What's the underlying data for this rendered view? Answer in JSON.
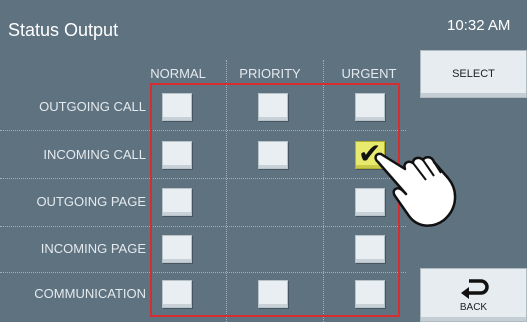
{
  "header": {
    "title": "Status Output",
    "time": "10:32 AM"
  },
  "columns": [
    "NORMAL",
    "PRIORITY",
    "URGENT"
  ],
  "rows": [
    {
      "label": "OUTGOING CALL",
      "cells": [
        false,
        false,
        false
      ]
    },
    {
      "label": "INCOMING CALL",
      "cells": [
        false,
        false,
        true
      ]
    },
    {
      "label": "OUTGOING PAGE",
      "cells": [
        false,
        null,
        false
      ]
    },
    {
      "label": "INCOMING PAGE",
      "cells": [
        false,
        null,
        false
      ]
    },
    {
      "label": "COMMUNICATION",
      "cells": [
        false,
        false,
        false
      ]
    }
  ],
  "buttons": {
    "select": "SELECT",
    "back": "BACK"
  },
  "colors": {
    "background": "#5f7280",
    "highlight_frame": "#d62e30",
    "checked_fill": "#e8ea6e"
  },
  "icons": {
    "back": "back-arrow-icon",
    "pointer": "pointing-hand-icon",
    "check": "checkmark-icon"
  }
}
